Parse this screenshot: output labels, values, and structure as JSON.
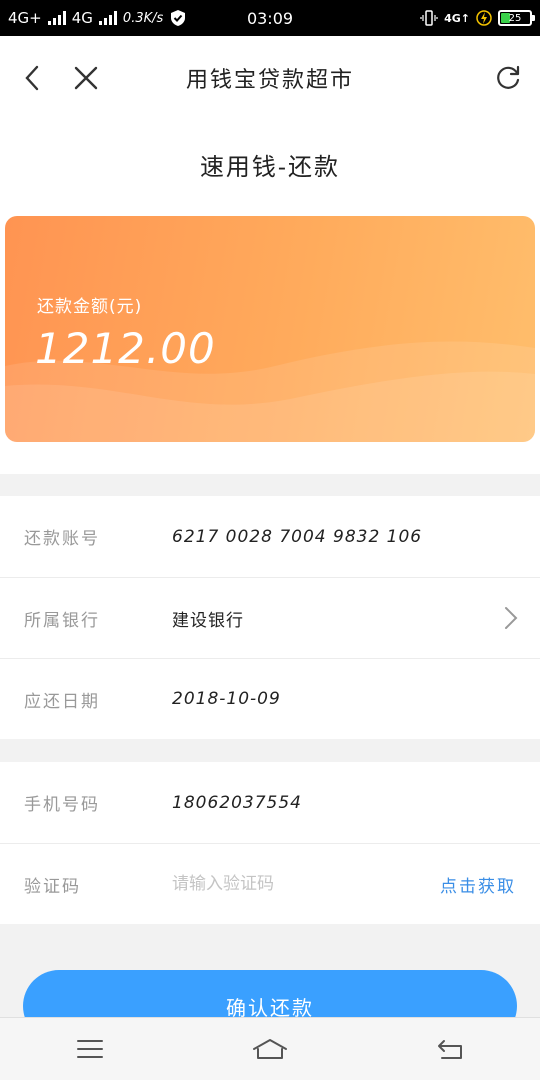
{
  "status_bar": {
    "network1": "4G+",
    "network2": "4G",
    "speed": "0.3K/s",
    "time": "03:09",
    "network3": "4G↑",
    "battery": "25"
  },
  "nav": {
    "title": "用钱宝贷款超市"
  },
  "page": {
    "title": "速用钱-还款"
  },
  "card": {
    "amount_label": "还款金额(元)",
    "amount_value": "1212.00",
    "gradient_start": "#ff9452",
    "gradient_end": "#ffbe6c"
  },
  "account_section": {
    "account_label": "还款账号",
    "account_value": "6217 0028 7004 9832 106",
    "bank_label": "所属银行",
    "bank_value": "建设银行",
    "due_label": "应还日期",
    "due_value": "2018-10-09"
  },
  "verify_section": {
    "phone_label": "手机号码",
    "phone_value": "18062037554",
    "code_label": "验证码",
    "code_placeholder": "请输入验证码",
    "get_code": "点击获取"
  },
  "confirm": {
    "label": "确认还款",
    "color": "#3aa0ff"
  },
  "icons": {
    "back": "chevron-left-icon",
    "close": "close-icon",
    "refresh": "refresh-icon",
    "menu": "menu-icon",
    "home": "home-icon",
    "return": "return-icon"
  }
}
